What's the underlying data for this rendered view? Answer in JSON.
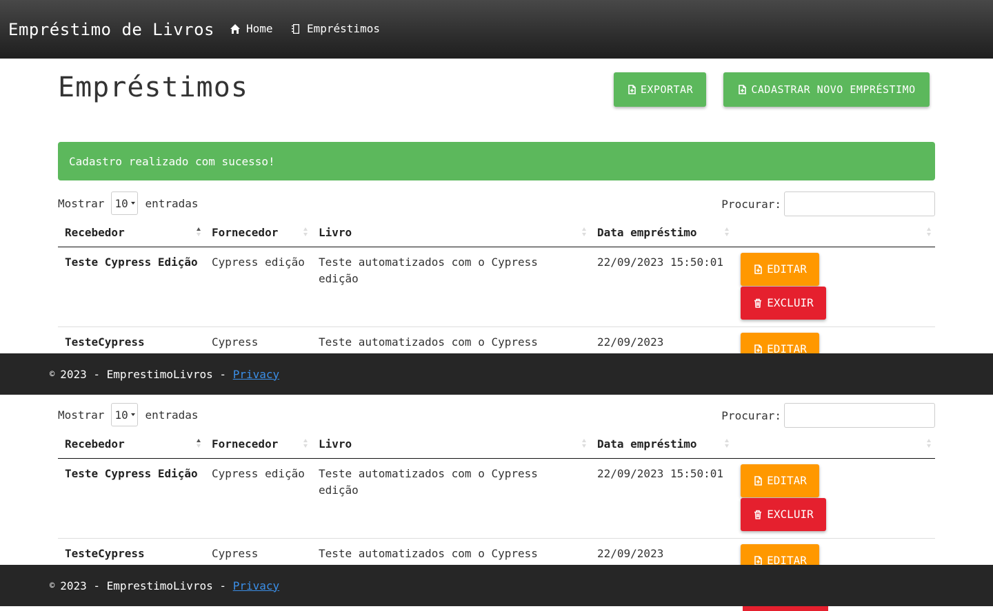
{
  "navbar": {
    "brand": "Empréstimo de Livros",
    "home_label": "Home",
    "loans_label": "Empréstimos"
  },
  "header": {
    "title": "Empréstimos",
    "export_label": "EXPORTAR",
    "new_label": "CADASTRAR NOVO EMPRÉSTIMO"
  },
  "alert": {
    "message": "Cadastro realizado com sucesso!"
  },
  "table": {
    "show_label": "Mostrar",
    "page_size": "10",
    "entries_label": "entradas",
    "search_label": "Procurar:",
    "columns": [
      "Recebedor",
      "Fornecedor",
      "Livro",
      "Data empréstimo",
      ""
    ],
    "rows": [
      {
        "recebedor": "Teste Cypress Edição",
        "fornecedor": "Cypress edição",
        "livro": "Teste automatizados com o Cypress edição",
        "data": "22/09/2023 15:50:01"
      },
      {
        "recebedor": "TesteCypress",
        "fornecedor": "Cypress",
        "livro": "Teste automatizados com o Cypress",
        "data": "22/09/2023"
      }
    ],
    "edit_label": "EDITAR",
    "delete_label": "EXCLUIR"
  },
  "footer": {
    "copyright_symbol": "©",
    "text": "2023 - EmprestimoLivros -",
    "privacy_label": "Privacy"
  },
  "colors": {
    "success": "#5cb85c",
    "warning": "#ff9800",
    "danger": "#e5202e",
    "navbar": "#2e2e2e",
    "footer": "#262626",
    "link": "#3b8fe8"
  }
}
